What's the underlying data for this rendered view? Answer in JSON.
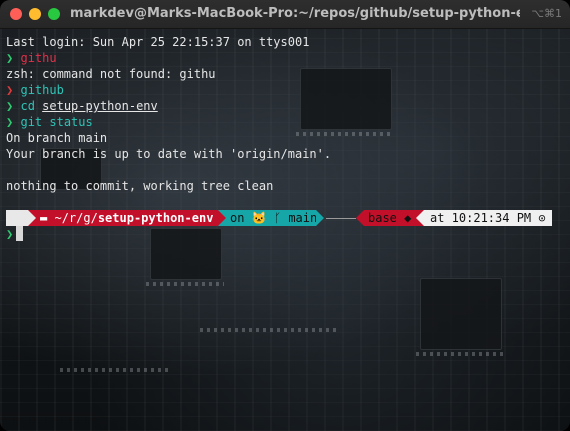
{
  "window": {
    "title": "markdev@Marks-MacBook-Pro:~/repos/github/setup-python-env",
    "shortcut": "⌥⌘1"
  },
  "terminal": {
    "last_login": "Last login: Sun Apr 25 22:15:37 on ttys001",
    "chevron": "❯",
    "cmd1": "githu",
    "error1": "zsh: command not found: githu",
    "cmd2": "github",
    "cmd3_cmd": "cd",
    "cmd3_arg": "setup-python-env",
    "cmd4": "git status",
    "out1": "On branch main",
    "out2": "Your branch is up to date with 'origin/main'.",
    "out3": "nothing to commit, working tree clean"
  },
  "prompt": {
    "apple_icon": "",
    "folder_icon": "▬",
    "path_prefix": "~/r/g/",
    "path_dir": "setup-python-env",
    "git_on": "on",
    "git_icon": "🐱",
    "branch_icon": "ᚴ",
    "branch": "main",
    "env": "base",
    "env_icon": "◆",
    "time": "at 10:21:34 PM",
    "clock_icon": "⊙"
  },
  "colors": {
    "red_segment": "#c3102a",
    "teal_segment": "#17a6a8",
    "green_chevron": "#2ecc71",
    "error_command": "#e0304a"
  }
}
